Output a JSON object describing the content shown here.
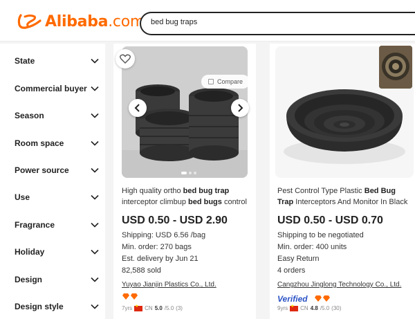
{
  "header": {
    "logo_text": "Alibaba",
    "logo_suffix": ".com",
    "search_value": "bed bug traps"
  },
  "sidebar": {
    "filters": [
      {
        "label": "State"
      },
      {
        "label": "Commercial buyer"
      },
      {
        "label": "Season"
      },
      {
        "label": "Room space"
      },
      {
        "label": "Power source"
      },
      {
        "label": "Use"
      },
      {
        "label": "Fragrance"
      },
      {
        "label": "Holiday"
      },
      {
        "label": "Design"
      },
      {
        "label": "Design style"
      }
    ]
  },
  "products": [
    {
      "title_parts": [
        "High quality ortho ",
        "bed bug trap",
        " interceptor climbup ",
        "bed bugs",
        " control"
      ],
      "compare_label": "Compare",
      "price": "USD 0.50 - USD 2.90",
      "shipping": "Shipping: USD 6.56 /bag",
      "min_order": "Min. order: 270 bags",
      "delivery": "Est. delivery by Jun 21",
      "sold": "82,588 sold",
      "supplier": "Yuyao Jianjin Plastics Co., Ltd.",
      "years": "7yrs",
      "country": "CN",
      "rating": "5.0",
      "rating_max": "/5.0",
      "reviews": "(3)"
    },
    {
      "title_parts": [
        "Pest Control Type Plastic ",
        "Bed Bug Trap",
        " Interceptors And Monitor In Black"
      ],
      "price": "USD 0.50 - USD 0.70",
      "shipping": "Shipping to be negotiated",
      "min_order": "Min. order: 400 units",
      "return": "Easy Return",
      "orders": "4 orders",
      "supplier": "Cangzhou Jinglong Technology Co., Ltd.",
      "verified": "Verified",
      "years": "9yrs",
      "country": "CN",
      "rating": "4.8",
      "rating_max": "/5.0",
      "reviews": "(30)"
    }
  ],
  "colors": {
    "brand": "#ff6a00",
    "verified": "#2b53c5",
    "diamond": "#ff6a00"
  }
}
